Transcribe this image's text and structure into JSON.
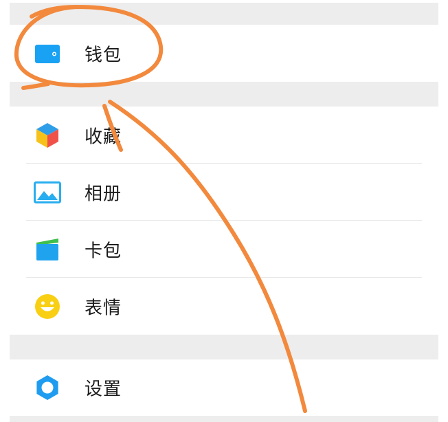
{
  "menu": {
    "wallet_label": "钱包",
    "favorites_label": "收藏",
    "album_label": "相册",
    "cards_label": "卡包",
    "stickers_label": "表情",
    "settings_label": "设置"
  },
  "icons": {
    "wallet": "wallet-icon",
    "favorites": "cube-icon",
    "album": "photo-icon",
    "cards": "card-holder-icon",
    "stickers": "smiley-icon",
    "settings": "gear-icon"
  },
  "colors": {
    "wallet_blue": "#19a2f4",
    "annotation_orange": "#f2893d",
    "album_blue": "#27aef0",
    "smiley_yellow": "#f9cf13",
    "settings_blue": "#1f9cf0"
  }
}
